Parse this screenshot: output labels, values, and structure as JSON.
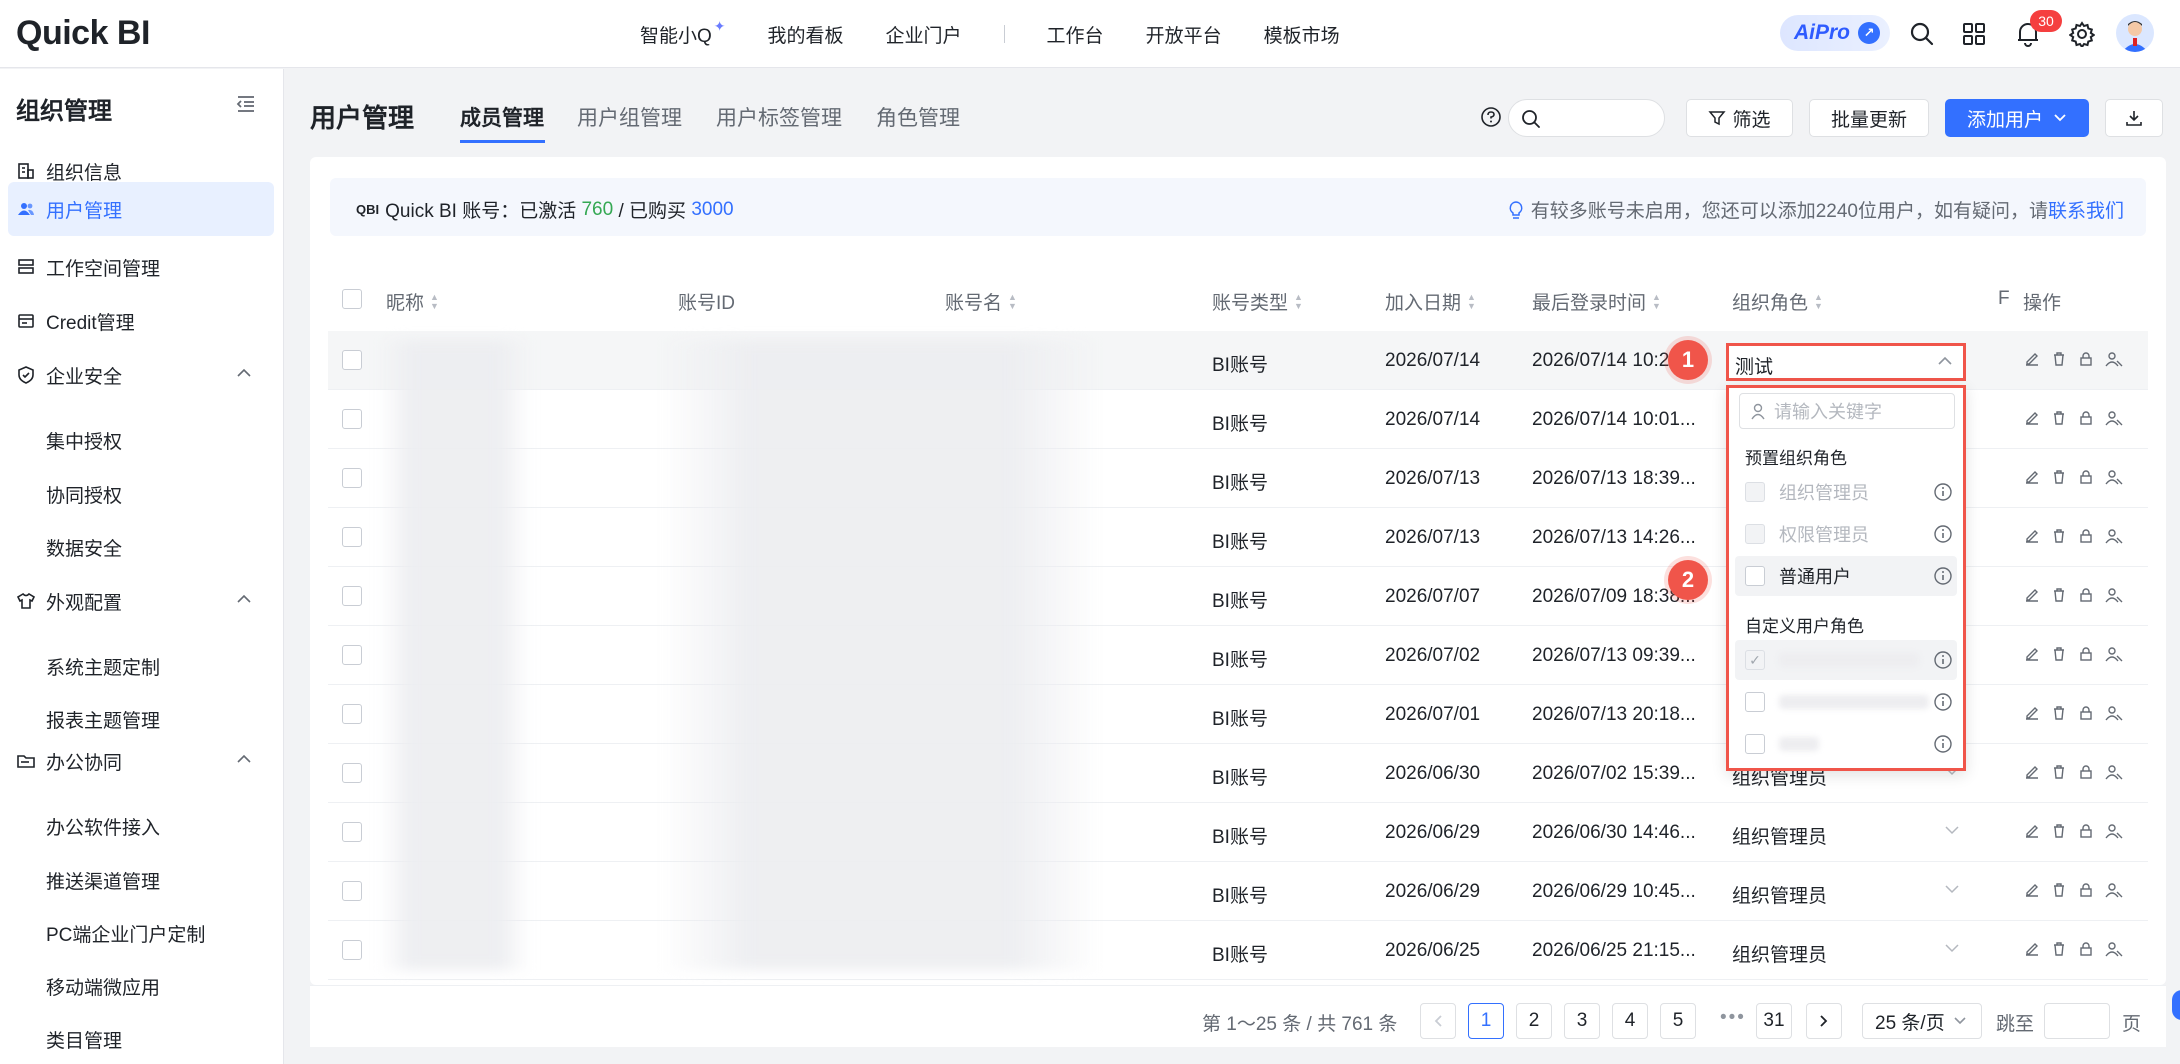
{
  "topnav": {
    "logo": "Quick BI",
    "menu": [
      "智能小Q",
      "我的看板",
      "企业门户",
      "工作台",
      "开放平台",
      "模板市场"
    ],
    "ai_label": "AiPro",
    "notification_count": "30"
  },
  "sidebar": {
    "title": "组织管理",
    "items": [
      {
        "label": "组织信息"
      },
      {
        "label": "用户管理"
      },
      {
        "label": "工作空间管理"
      },
      {
        "label": "Credit管理"
      },
      {
        "label": "企业安全"
      },
      {
        "label": "集中授权"
      },
      {
        "label": "协同授权"
      },
      {
        "label": "数据安全"
      },
      {
        "label": "外观配置"
      },
      {
        "label": "系统主题定制"
      },
      {
        "label": "报表主题管理"
      },
      {
        "label": "办公协同"
      },
      {
        "label": "办公软件接入"
      },
      {
        "label": "推送渠道管理"
      },
      {
        "label": "PC端企业门户定制"
      },
      {
        "label": "移动端微应用"
      },
      {
        "label": "类目管理"
      }
    ]
  },
  "header": {
    "title": "用户管理",
    "tabs": [
      "成员管理",
      "用户组管理",
      "用户标签管理",
      "角色管理"
    ],
    "filter_label": "筛选",
    "batch_update_label": "批量更新",
    "add_user_label": "添加用户"
  },
  "notice": {
    "account_label": "Quick BI 账号：已激活",
    "activated": "760",
    "sep": "/ 已购买",
    "purchased": "3000",
    "tip": "有较多账号未启用，您还可以添加2240位用户，如有疑问，请",
    "contact": "联系我们"
  },
  "table": {
    "columns": [
      "昵称",
      "账号ID",
      "账号名",
      "账号类型",
      "加入日期",
      "最后登录时间",
      "组织角色",
      "F",
      "操作"
    ],
    "rows": [
      {
        "type": "BI账号",
        "join": "2026/07/14",
        "last": "2026/07/14 10:2",
        "role": ""
      },
      {
        "type": "BI账号",
        "join": "2026/07/14",
        "last": "2026/07/14 10:01...",
        "role": ""
      },
      {
        "type": "BI账号",
        "join": "2026/07/13",
        "last": "2026/07/13 18:39...",
        "role": ""
      },
      {
        "type": "BI账号",
        "join": "2026/07/13",
        "last": "2026/07/13 14:26...",
        "role": ""
      },
      {
        "type": "BI账号",
        "join": "2026/07/07",
        "last": "2026/07/09 18:38...",
        "role": ""
      },
      {
        "type": "BI账号",
        "join": "2026/07/02",
        "last": "2026/07/13 09:39...",
        "role": ""
      },
      {
        "type": "BI账号",
        "join": "2026/07/01",
        "last": "2026/07/13 20:18...",
        "role": ""
      },
      {
        "type": "BI账号",
        "join": "2026/06/30",
        "last": "2026/07/02 15:39...",
        "role": "组织管理员"
      },
      {
        "type": "BI账号",
        "join": "2026/06/29",
        "last": "2026/06/30 14:46...",
        "role": "组织管理员"
      },
      {
        "type": "BI账号",
        "join": "2026/06/29",
        "last": "2026/06/29 10:45...",
        "role": "组织管理员"
      },
      {
        "type": "BI账号",
        "join": "2026/06/25",
        "last": "2026/06/25 21:15...",
        "role": "组织管理员"
      }
    ]
  },
  "role_dropdown": {
    "selected": "测试",
    "search_placeholder": "请输入关键字",
    "preset_group": "预置组织角色",
    "preset": [
      "组织管理员",
      "权限管理员",
      "普通用户"
    ],
    "custom_group": "自定义用户角色"
  },
  "markers": [
    "1",
    "2"
  ],
  "pagination": {
    "total": "第 1～25 条 / 共 761 条",
    "pages": [
      "1",
      "2",
      "3",
      "4",
      "5",
      "31"
    ],
    "page_size": "25 条/页",
    "jump_label": "跳至",
    "page_label": "页"
  }
}
